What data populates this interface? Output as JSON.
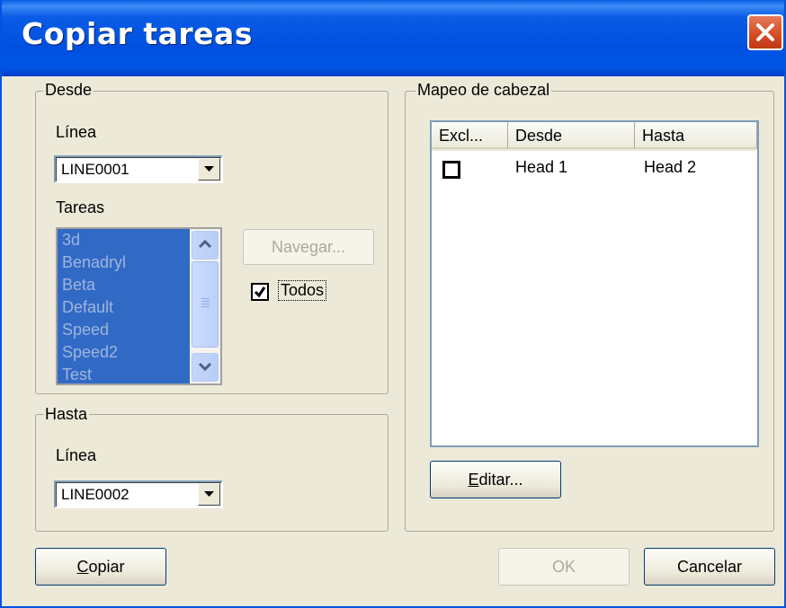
{
  "window": {
    "title": "Copiar tareas"
  },
  "desde": {
    "group_label": "Desde",
    "linea_label": "Línea",
    "linea_value": "LINE0001",
    "tareas_label": "Tareas",
    "tasks": [
      "3d",
      "Benadryl",
      "Beta",
      "Default",
      "Speed",
      "Speed2",
      "Test"
    ],
    "navegar_label": "Navegar...",
    "todos_label": "Todos",
    "todos_checked": true
  },
  "hasta": {
    "group_label": "Hasta",
    "linea_label": "Línea",
    "linea_value": "LINE0002"
  },
  "mapeo": {
    "group_label": "Mapeo de cabezal",
    "columns": [
      "Excl...",
      "Desde",
      "Hasta"
    ],
    "rows": [
      {
        "excluded": false,
        "desde": "Head 1",
        "hasta": "Head 2"
      }
    ],
    "editar_label": "Editar..."
  },
  "buttons": {
    "copiar": "Copiar",
    "ok": "OK",
    "cancelar": "Cancelar"
  },
  "colors": {
    "titlebar": "#0054e3",
    "selection": "#316ac5",
    "dialog_bg": "#ece9d8"
  },
  "icons": {
    "close": "close-icon",
    "dropdown": "chevron-down-icon",
    "scroll_up": "chevron-up-icon",
    "scroll_down": "chevron-down-icon",
    "check": "check-icon"
  }
}
